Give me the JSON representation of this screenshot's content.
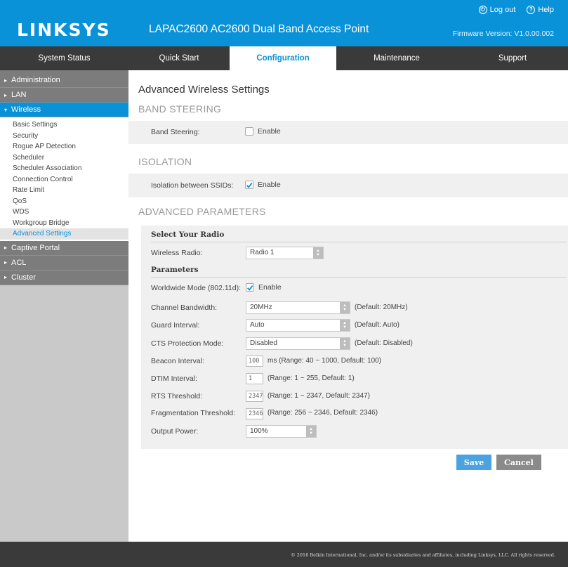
{
  "header": {
    "logo": "LINKSYS",
    "product": "LAPAC2600 AC2600 Dual Band Access Point",
    "logout": "Log out",
    "help": "Help",
    "firmware": "Firmware Version: V1.0.00.002"
  },
  "nav": {
    "tabs": [
      {
        "label": "System Status"
      },
      {
        "label": "Quick Start"
      },
      {
        "label": "Configuration"
      },
      {
        "label": "Maintenance"
      },
      {
        "label": "Support"
      }
    ],
    "active": "Configuration"
  },
  "sidebar": {
    "admin": "Administration",
    "lan": "LAN",
    "wireless": "Wireless",
    "wireless_items": [
      "Basic Settings",
      "Security",
      "Rogue AP Detection",
      "Scheduler",
      "Scheduler Association",
      "Connection Control",
      "Rate Limit",
      "QoS",
      "WDS",
      "Workgroup Bridge",
      "Advanced Settings"
    ],
    "captive": "Captive Portal",
    "acl": "ACL",
    "cluster": "Cluster"
  },
  "main": {
    "title": "Advanced Wireless Settings",
    "band_steering": {
      "heading": "BAND STEERING",
      "label": "Band Steering:",
      "checkbox_label": "Enable",
      "checked": false
    },
    "isolation": {
      "heading": "ISOLATION",
      "label": "Isolation between SSIDs:",
      "checkbox_label": "Enable",
      "checked": true
    },
    "advanced": {
      "heading": "ADVANCED PARAMETERS",
      "select_radio_heading": "Select Your Radio",
      "wireless_radio_label": "Wireless Radio:",
      "wireless_radio_value": "Radio 1",
      "parameters_heading": "Parameters",
      "worldwide_label": "Worldwide Mode (802.11d):",
      "worldwide_checkbox_label": "Enable",
      "worldwide_checked": true,
      "channel_bw_label": "Channel Bandwidth:",
      "channel_bw_value": "20MHz",
      "channel_bw_note": "(Default: 20MHz)",
      "guard_label": "Guard Interval:",
      "guard_value": "Auto",
      "guard_note": "(Default: Auto)",
      "cts_label": "CTS Protection Mode:",
      "cts_value": "Disabled",
      "cts_note": "(Default: Disabled)",
      "beacon_label": "Beacon Interval:",
      "beacon_value": "100",
      "beacon_note": "ms (Range: 40 ~ 1000, Default: 100)",
      "dtim_label": "DTIM Interval:",
      "dtim_value": "1",
      "dtim_note": "(Range: 1 ~ 255, Default: 1)",
      "rts_label": "RTS Threshold:",
      "rts_value": "2347",
      "rts_note": "(Range: 1 ~ 2347, Default: 2347)",
      "frag_label": "Fragmentation Threshold:",
      "frag_value": "2346",
      "frag_note": "(Range: 256 ~ 2346, Default: 2346)",
      "output_label": "Output Power:",
      "output_value": "100%"
    },
    "save": "Save",
    "cancel": "Cancel"
  },
  "footer": "© 2016 Belkin International, Inc. and/or its subsidiaries and affiliates, including Linksys, LLC. All rights reserved.",
  "colors": {
    "brand_blue": "#0a92d9",
    "nav_dark": "#3a3a3a",
    "sidebar_gray": "#c9c9c9"
  }
}
